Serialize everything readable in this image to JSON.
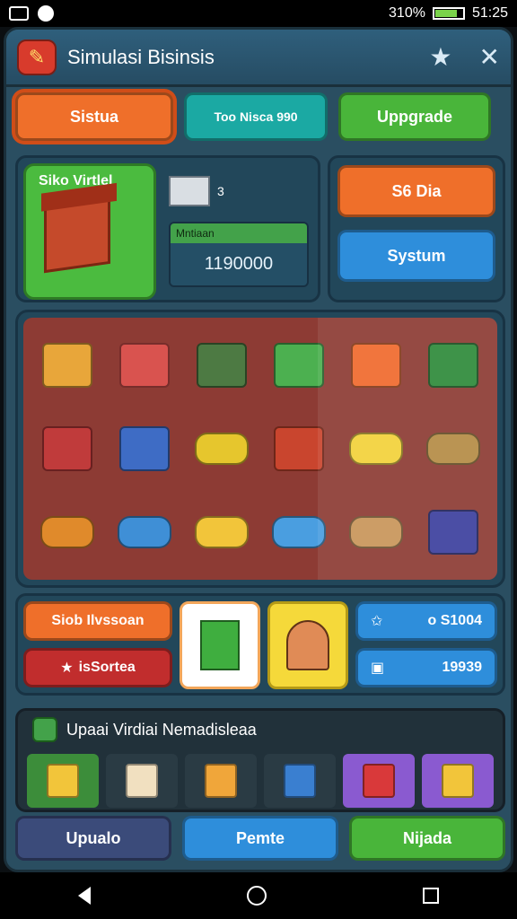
{
  "status_bar": {
    "battery": "310%",
    "time": "51:25"
  },
  "window": {
    "title": "Simulasi Bisinsis",
    "actions": [
      {
        "icon": "star-icon"
      },
      {
        "icon": "close-icon"
      }
    ]
  },
  "top_buttons": [
    {
      "label": "Sistua",
      "color": "#ef6f2a"
    },
    {
      "label": "Too Nisca 990",
      "color": "#1ba9a3"
    },
    {
      "label": "Uppgrade",
      "color": "#49b53a"
    }
  ],
  "shop": {
    "label": "Siko Virtlel",
    "building_count": "3",
    "stat_label": "Mntiaan",
    "stat_value": "1190000",
    "side_buttons": [
      {
        "label": "S6 Dia",
        "color": "#ef6f2a"
      },
      {
        "label": "Systum",
        "color": "#2e8edb"
      }
    ]
  },
  "grid_items": [
    {
      "name": "market-stall-yellow-icon",
      "color": "#e8a63a"
    },
    {
      "name": "market-stall-red-icon",
      "color": "#d9534f"
    },
    {
      "name": "shop-kiosk-icon",
      "color": "#4d7a43"
    },
    {
      "name": "green-roof-stand-icon",
      "color": "#4cb050"
    },
    {
      "name": "rainbow-stall-icon",
      "color": "#f06a2d"
    },
    {
      "name": "green-machine-icon",
      "color": "#2e8a3a"
    },
    {
      "name": "striped-stall-icon",
      "color": "#c03b3b"
    },
    {
      "name": "vending-machine-icon",
      "color": "#3e6cc5"
    },
    {
      "name": "yellow-cart-icon",
      "color": "#e6c62d"
    },
    {
      "name": "food-stand-icon",
      "color": "#c9452e"
    },
    {
      "name": "yellow-car-icon",
      "color": "#f2d23a"
    },
    {
      "name": "delivery-cart-icon",
      "color": "#b58b45"
    },
    {
      "name": "orange-cart-icon",
      "color": "#e08a2b"
    },
    {
      "name": "blue-van-icon",
      "color": "#3f8fd6"
    },
    {
      "name": "yellow-van-icon",
      "color": "#f2c53a"
    },
    {
      "name": "blue-car-icon",
      "color": "#4a9ee0"
    },
    {
      "name": "cardboard-box-icon",
      "color": "#c8955a"
    },
    {
      "name": "arcade-machine-icon",
      "color": "#3c3f9e"
    }
  ],
  "middle": {
    "left_buttons": [
      {
        "label": "Siob Ilvssoan",
        "color": "#ef6f2a"
      },
      {
        "label": "isSortea",
        "color": "#c12d2d",
        "icon": "star-icon"
      }
    ],
    "cards": [
      {
        "name": "green-box-card",
        "bg": "white"
      },
      {
        "name": "worker-card",
        "bg": "yellow"
      }
    ],
    "right_stats": [
      {
        "icon": "star-icon",
        "label": "o S1004"
      },
      {
        "icon": "bag-icon",
        "label": "19939"
      }
    ]
  },
  "inventory": {
    "title": "Upaai Virdiai Nemadisleaa",
    "items": [
      {
        "name": "green-crate-item",
        "bg": "#3c8d3a",
        "icon_color": "#f2c53a"
      },
      {
        "name": "milkshake-item",
        "bg": "#2a3b44",
        "icon_color": "#f1e0c0"
      },
      {
        "name": "juice-cup-item",
        "bg": "#2a3b44",
        "icon_color": "#f0a63a"
      },
      {
        "name": "soda-can-item",
        "bg": "#2a3b44",
        "icon_color": "#3a7fd0"
      },
      {
        "name": "red-machine-item",
        "bg": "#8a5ad0",
        "icon_color": "#d9393a"
      },
      {
        "name": "yellow-truck-item",
        "bg": "#8a5ad0",
        "icon_color": "#f2c53a"
      }
    ]
  },
  "bottom_buttons": [
    {
      "label": "Upualo",
      "color": "#3b4b7a"
    },
    {
      "label": "Pemte",
      "color": "#2e8edb"
    },
    {
      "label": "Nijada",
      "color": "#49b53a"
    }
  ]
}
